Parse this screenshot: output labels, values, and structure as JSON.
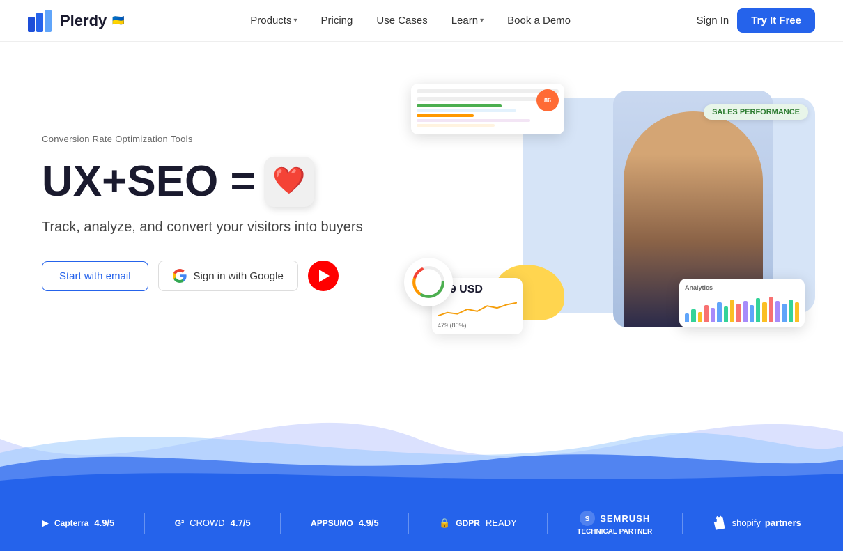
{
  "header": {
    "logo_text": "Plerdy",
    "logo_flag": "🇺🇦",
    "nav": [
      {
        "label": "Products",
        "has_dropdown": true
      },
      {
        "label": "Pricing",
        "has_dropdown": false
      },
      {
        "label": "Use Cases",
        "has_dropdown": false
      },
      {
        "label": "Learn",
        "has_dropdown": true
      },
      {
        "label": "Book a Demo",
        "has_dropdown": false
      }
    ],
    "sign_in": "Sign In",
    "try_free": "Try It Free"
  },
  "hero": {
    "subtitle": "Conversion Rate Optimization Tools",
    "headline_text": "UX+SEO =",
    "tagline": "Track, analyze, and convert your visitors into buyers",
    "cta_email": "Start with email",
    "cta_google": "Sign in with Google",
    "sales_badge": "SALES PERFORMANCE",
    "revenue_amount": "709 USD",
    "revenue_label": "479 (86%)"
  },
  "bottom_bar": {
    "ratings": [
      {
        "logo": "▶ Capterra",
        "score": "4.9/5"
      },
      {
        "logo": "G² CROWD",
        "score": "4.7/5"
      },
      {
        "logo": "APPSUMO",
        "score": "4.9/5"
      },
      {
        "logo": "🔒 GDPR",
        "score": "READY"
      }
    ],
    "semrush_label": "SEMRUSH",
    "semrush_sub": "TECHNICAL PARTNER",
    "shopify_label": "shopify partners"
  },
  "analytics_bars": [
    30,
    45,
    35,
    60,
    50,
    70,
    55,
    80,
    65,
    75,
    60,
    85,
    70,
    90,
    75,
    65,
    80,
    70
  ],
  "colors": {
    "primary": "#2563eb",
    "accent": "#ff6b35",
    "green": "#4caf50",
    "yellow": "#ffd54f"
  }
}
